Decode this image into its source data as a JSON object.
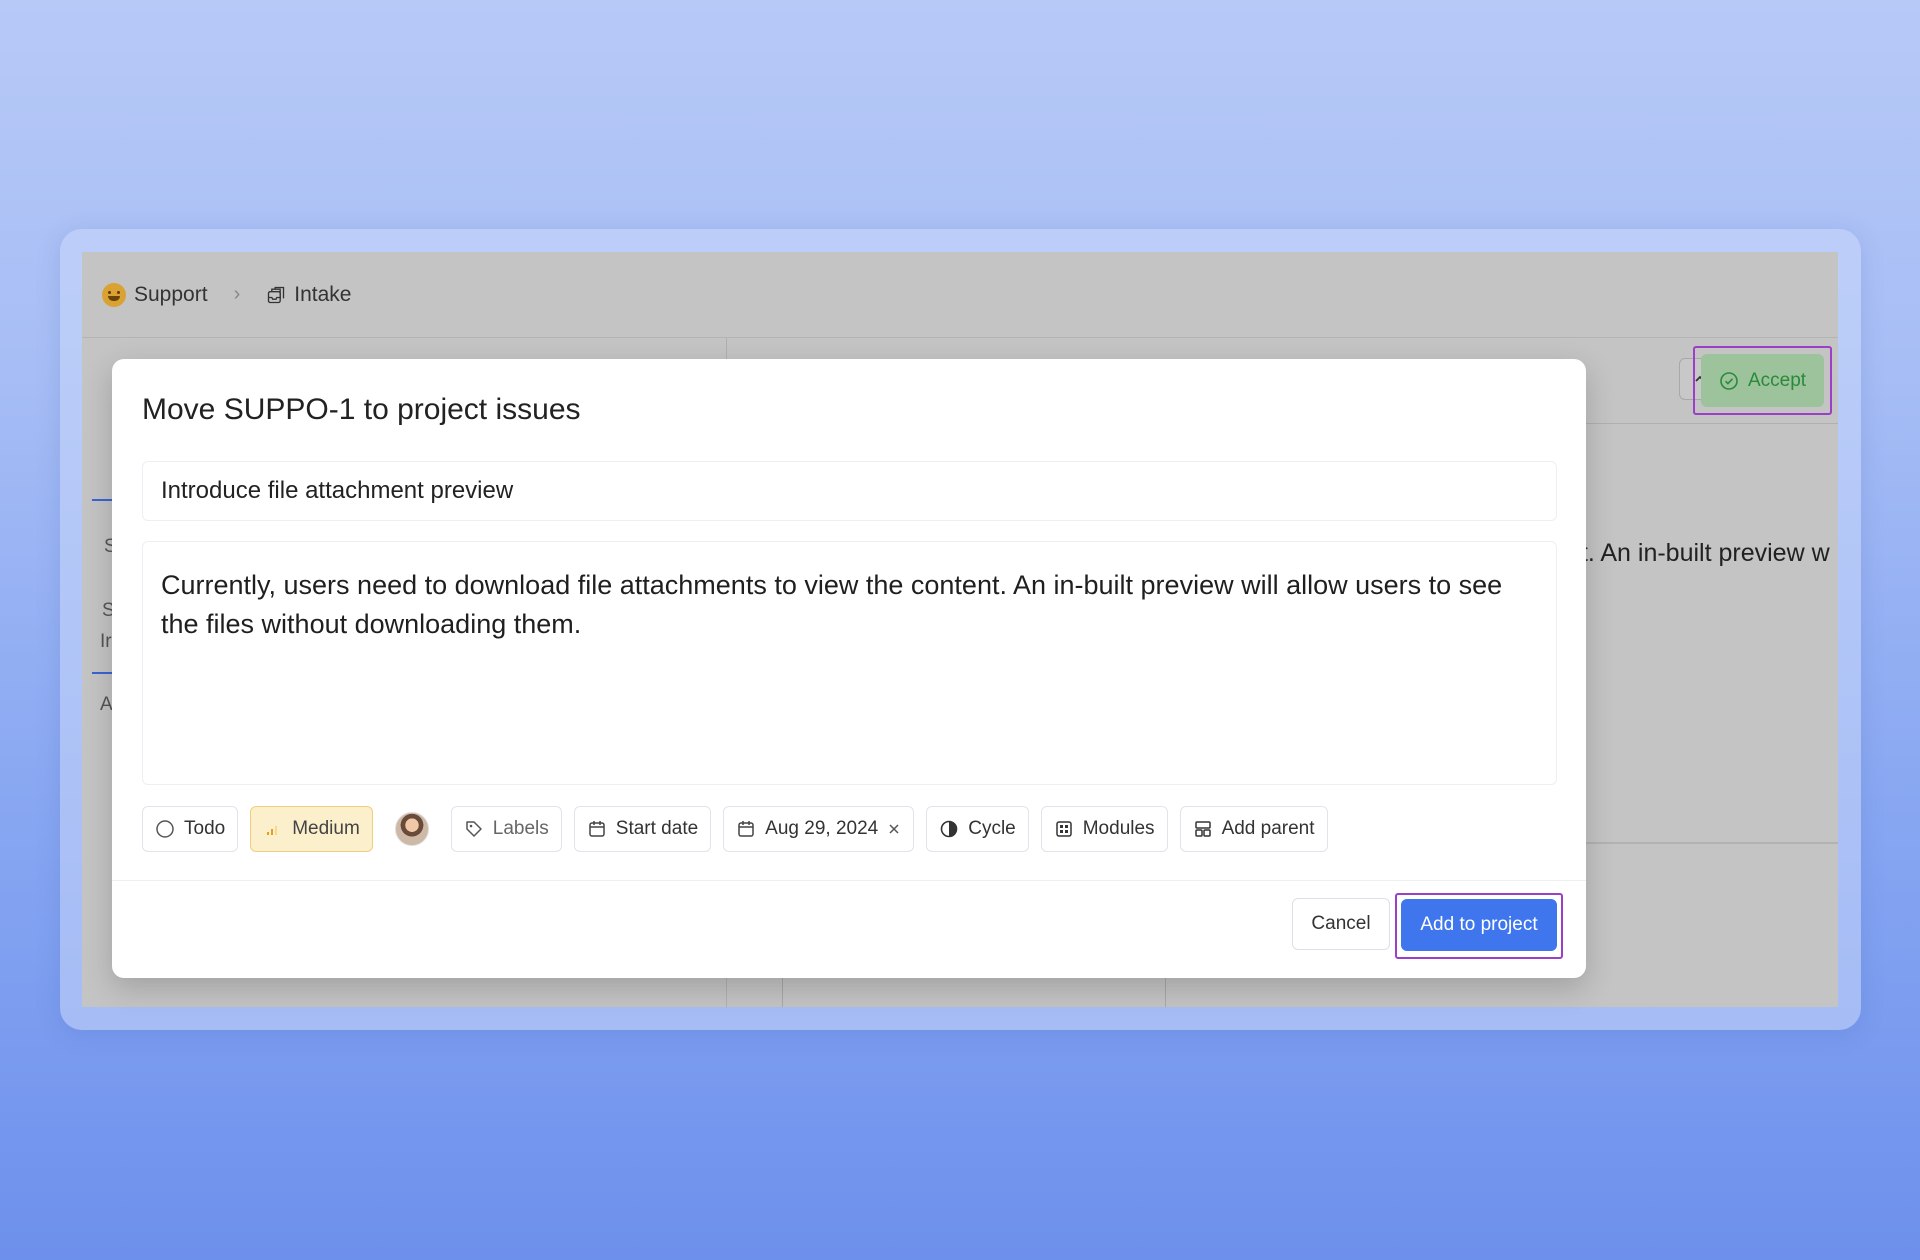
{
  "breadcrumb": {
    "project": "Support",
    "page": "Intake"
  },
  "background": {
    "accept_label": "Accept",
    "description_fragment": "nt. An in-built preview w",
    "left_fragments": [
      "S",
      "S",
      "Ir",
      "A"
    ]
  },
  "modal": {
    "title": "Move SUPPO-1 to project issues",
    "issue_title": "Introduce file attachment preview",
    "description": "Currently, users need to download file attachments to view the content. An in-built preview will allow users to see the files without downloading them.",
    "properties": {
      "state": "Todo",
      "priority": "Medium",
      "labels": "Labels",
      "start_date": "Start date",
      "due_date": "Aug 29, 2024",
      "cycle": "Cycle",
      "modules": "Modules",
      "parent": "Add parent"
    },
    "cancel_label": "Cancel",
    "submit_label": "Add to project"
  },
  "colors": {
    "primary": "#3f76ee",
    "accept_green": "#2a8a3a",
    "priority_bg": "#fbefcc",
    "highlight": "#9b3fc6"
  }
}
